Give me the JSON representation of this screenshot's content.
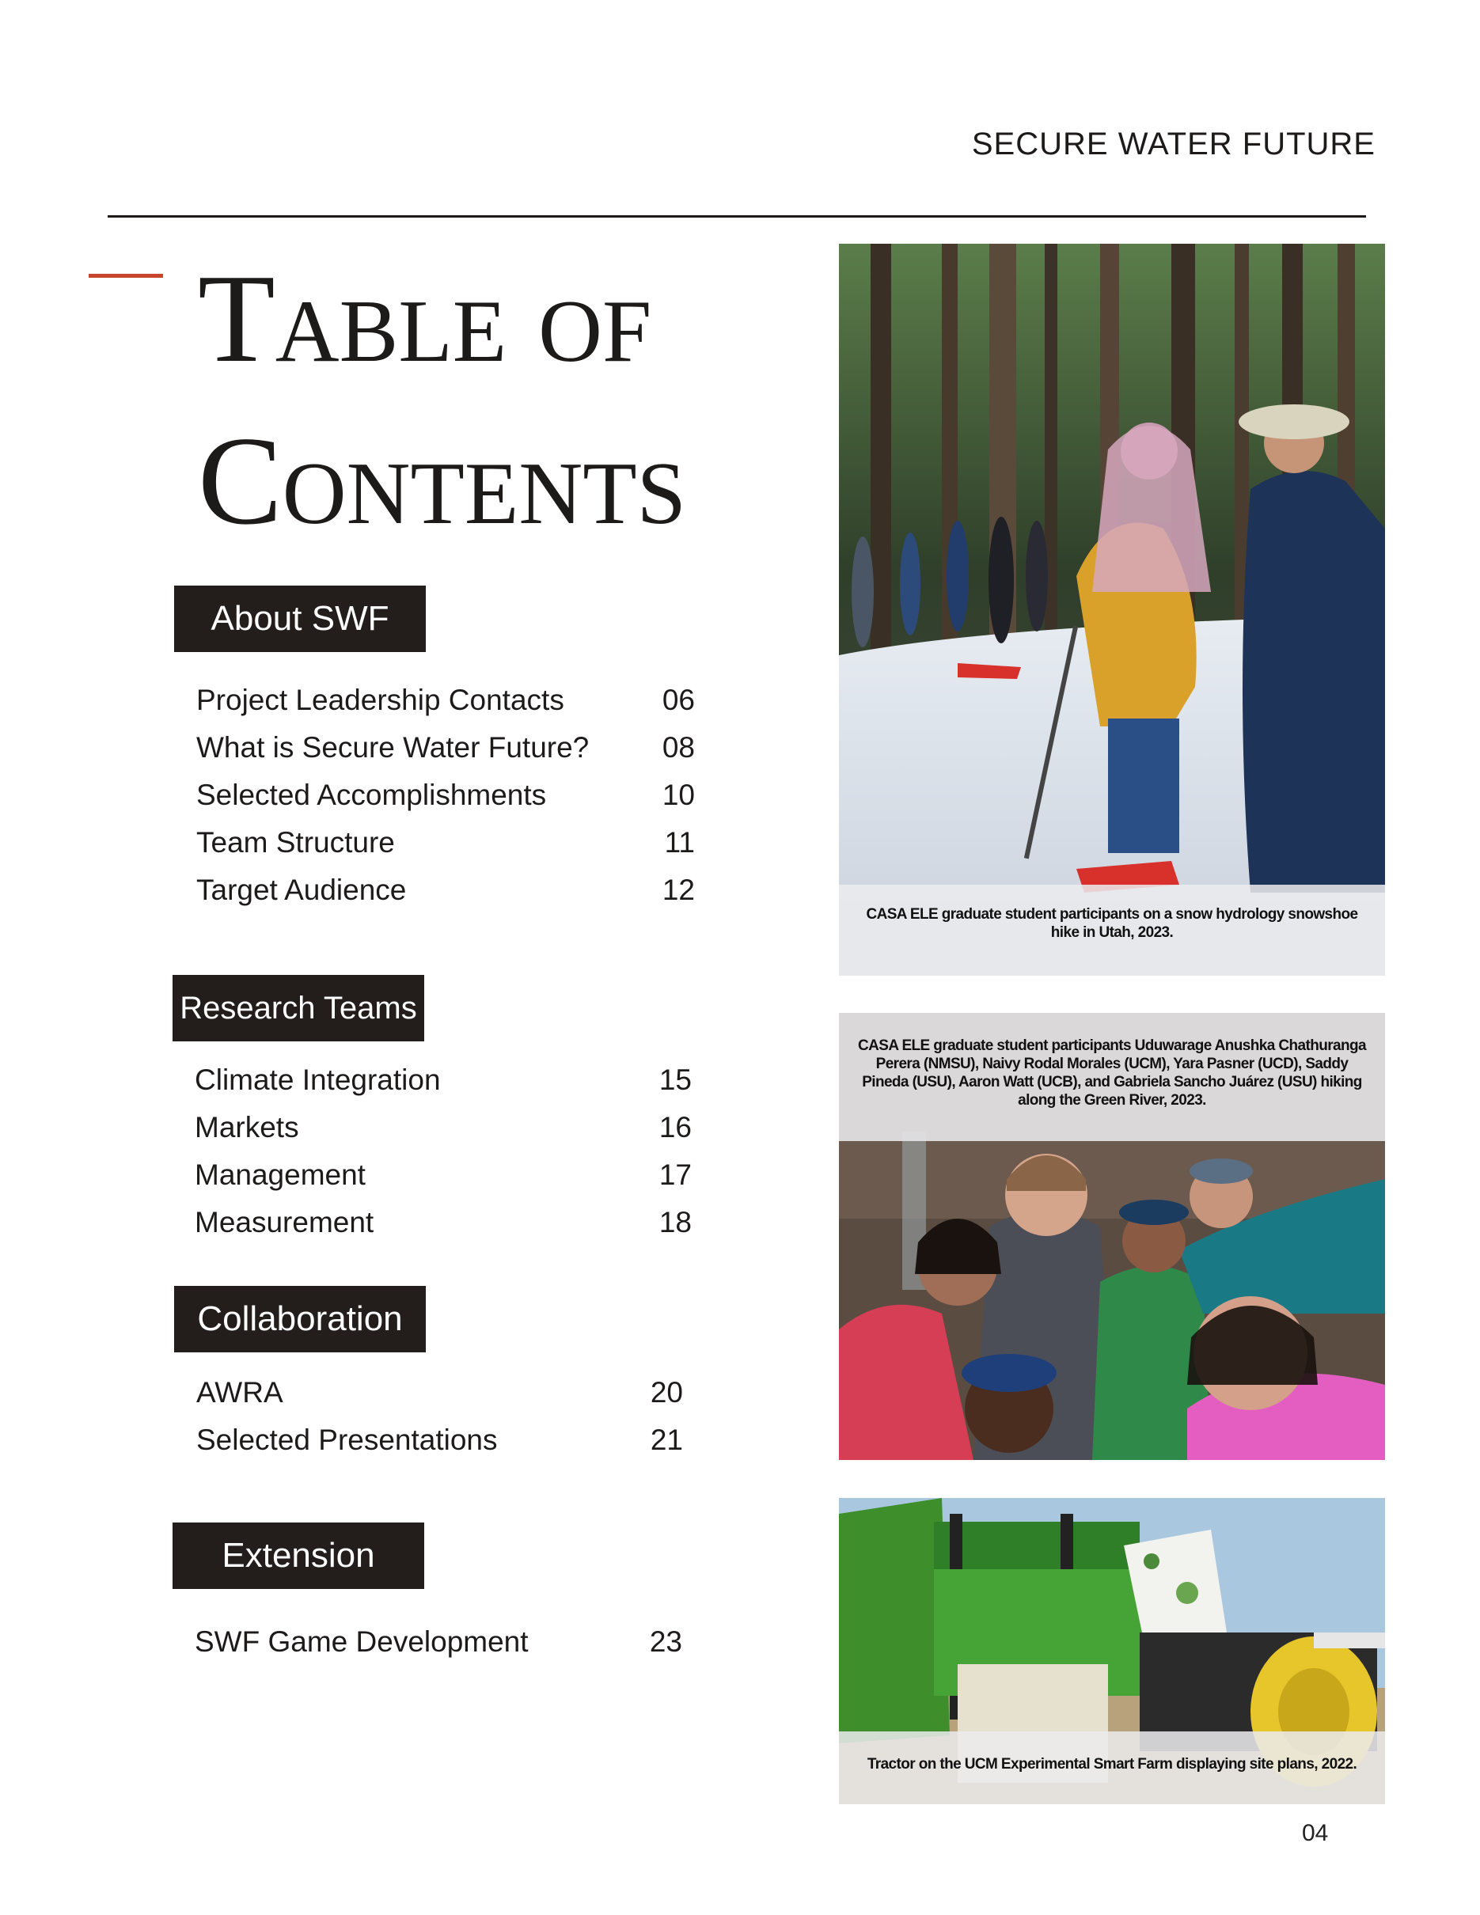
{
  "header": {
    "title": "SECURE WATER FUTURE"
  },
  "colors": {
    "accent": "#c8452e",
    "label_bg": "#231d1c",
    "text": "#1d1a1a"
  },
  "toc": {
    "title_line1": "Table of",
    "title_line2": "Contents",
    "sections": [
      {
        "label": "About SWF",
        "items": [
          {
            "label": "Project Leadership Contacts",
            "page": "06"
          },
          {
            "label": "What is Secure Water Future?",
            "page": "08"
          },
          {
            "label": "Selected Accomplishments",
            "page": "10"
          },
          {
            "label": "Team Structure",
            "page": "11"
          },
          {
            "label": "Target Audience",
            "page": "12"
          }
        ]
      },
      {
        "label": "Research Teams",
        "items": [
          {
            "label": "Climate Integration",
            "page": "15"
          },
          {
            "label": "Markets",
            "page": "16"
          },
          {
            "label": "Management",
            "page": "17"
          },
          {
            "label": "Measurement",
            "page": "18"
          }
        ]
      },
      {
        "label": "Collaboration",
        "items": [
          {
            "label": "AWRA",
            "page": "20"
          },
          {
            "label": "Selected Presentations",
            "page": "21"
          }
        ]
      },
      {
        "label": "Extension",
        "items": [
          {
            "label": "SWF Game Development",
            "page": "23"
          }
        ]
      }
    ]
  },
  "photos": [
    {
      "caption": "CASA ELE graduate student participants on a snow hydrology snowshoe hike in Utah, 2023."
    },
    {
      "caption": "CASA ELE graduate student participants Uduwarage Anushka Chathuranga Perera (NMSU), Naivy Rodal Morales (UCM), Yara Pasner (UCD), Saddy Pineda (USU), Aaron Watt (UCB), and Gabriela Sancho Juárez (USU) hiking along the Green River, 2023."
    },
    {
      "caption": "Tractor on  the UCM Experimental Smart Farm displaying site plans, 2022."
    }
  ],
  "footer": {
    "page_number": "04"
  }
}
